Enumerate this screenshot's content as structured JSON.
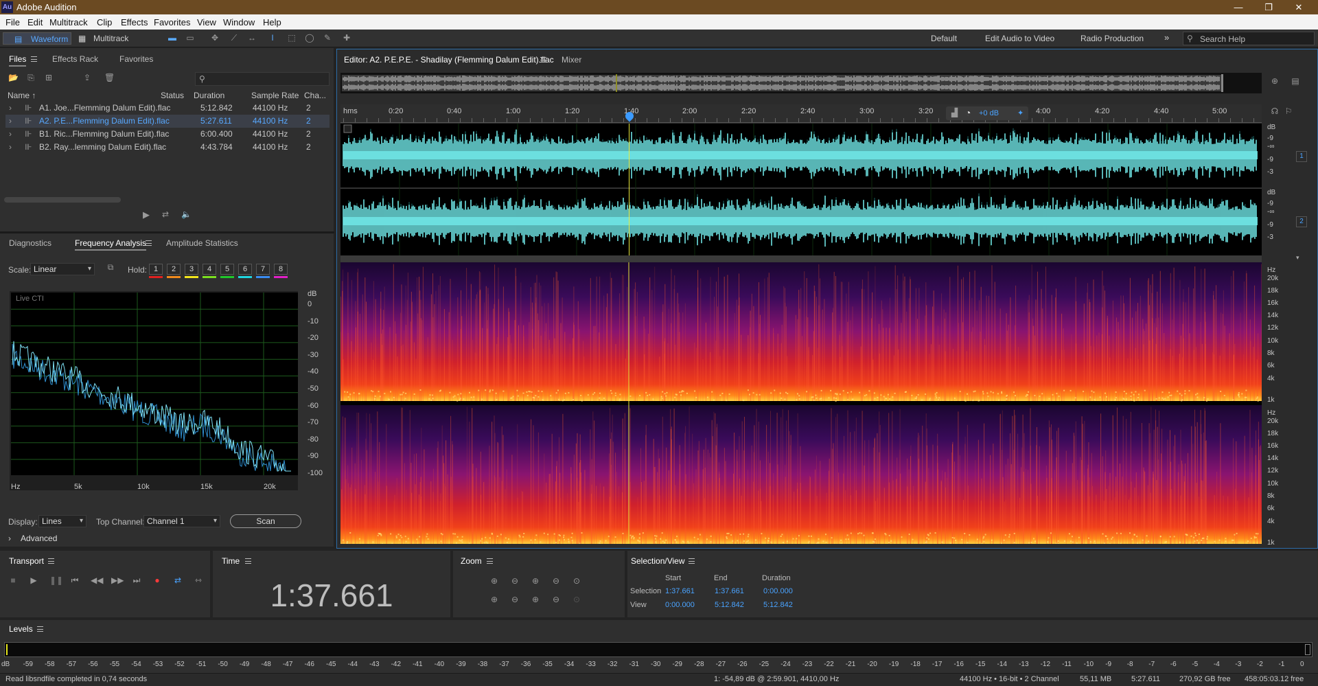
{
  "app": {
    "title": "Adobe Audition",
    "logo": "Au"
  },
  "menu": [
    "File",
    "Edit",
    "Multitrack",
    "Clip",
    "Effects",
    "Favorites",
    "View",
    "Window",
    "Help"
  ],
  "toolbar": {
    "waveform_label": "Waveform",
    "multitrack_label": "Multitrack",
    "workspaces": [
      "Default",
      "Edit Audio to Video",
      "Radio Production"
    ],
    "more": "»",
    "search_placeholder": "Search Help"
  },
  "files_panel": {
    "tabs": [
      "Files",
      "Effects Rack",
      "Favorites"
    ],
    "columns": [
      "Name ↑",
      "Status",
      "Duration",
      "Sample Rate",
      "Cha..."
    ],
    "rows": [
      {
        "name": "A1. Joe...Flemming Dalum Edit).flac",
        "duration": "5:12.842",
        "rate": "44100 Hz",
        "ch": "2",
        "selected": false
      },
      {
        "name": "A2. P.E...Flemming Dalum Edit).flac",
        "duration": "5:27.611",
        "rate": "44100 Hz",
        "ch": "2",
        "selected": true
      },
      {
        "name": "B1. Ric...Flemming Dalum Edit).flac",
        "duration": "6:00.400",
        "rate": "44100 Hz",
        "ch": "2",
        "selected": false
      },
      {
        "name": "B2. Ray...lemming Dalum Edit).flac",
        "duration": "4:43.784",
        "rate": "44100 Hz",
        "ch": "2",
        "selected": false
      }
    ]
  },
  "analysis_panel": {
    "tabs": [
      "Diagnostics",
      "Frequency Analysis",
      "Amplitude Statistics"
    ],
    "scale_label": "Scale:",
    "scale_value": "Linear",
    "hold_label": "Hold:",
    "hold_buttons": [
      "1",
      "2",
      "3",
      "4",
      "5",
      "6",
      "7",
      "8"
    ],
    "hold_colors": [
      "#e0201f",
      "#f08a1c",
      "#f2e51b",
      "#7be01f",
      "#1fc72a",
      "#1fd6e0",
      "#3a8cf2",
      "#e01fc7"
    ],
    "graph_label": "Live CTI",
    "db_unit": "dB",
    "db_ticks": [
      "0",
      "-10",
      "-20",
      "-30",
      "-40",
      "-50",
      "-60",
      "-70",
      "-80",
      "-90",
      "-100"
    ],
    "hz_ticks": [
      "Hz",
      "5k",
      "10k",
      "15k",
      "20k"
    ],
    "display_label": "Display:",
    "display_value": "Lines",
    "top_channel_label": "Top Channel:",
    "top_channel_value": "Channel 1",
    "scan_label": "Scan",
    "advanced_label": "Advanced"
  },
  "editor": {
    "tab_title": "Editor: A2. P.E.P.E. - Shadilay (Flemming Dalum Edit).flac",
    "mixer_tab": "Mixer",
    "ruler_unit": "hms",
    "ruler_ticks": [
      "0:20",
      "0:40",
      "1:00",
      "1:20",
      "1:40",
      "2:00",
      "2:20",
      "2:40",
      "3:00",
      "3:20",
      "4:00",
      "4:20",
      "4:40",
      "5:00"
    ],
    "gain_label": "+0 dB",
    "wave_db_labels": [
      "dB",
      "-9",
      "-∞",
      "-9",
      "-3"
    ],
    "channel_badges": [
      "1",
      "2"
    ],
    "spec_labels": [
      "Hz",
      "20k",
      "18k",
      "16k",
      "14k",
      "12k",
      "10k",
      "8k",
      "6k",
      "4k",
      "1k"
    ],
    "waveform_color": "#6fe3e3"
  },
  "transport": {
    "title": "Transport"
  },
  "time_panel": {
    "title": "Time",
    "current": "1:37.661"
  },
  "zoom_panel": {
    "title": "Zoom"
  },
  "selection_panel": {
    "title": "Selection/View",
    "headers": [
      "Start",
      "End",
      "Duration"
    ],
    "selection_label": "Selection",
    "selection": [
      "1:37.661",
      "1:37.661",
      "0:00.000"
    ],
    "view_label": "View",
    "view": [
      "0:00.000",
      "5:12.842",
      "5:12.842"
    ]
  },
  "levels": {
    "title": "Levels",
    "ticks": [
      "dB",
      "-59",
      "-58",
      "-57",
      "-56",
      "-55",
      "-54",
      "-53",
      "-52",
      "-51",
      "-50",
      "-49",
      "-48",
      "-47",
      "-46",
      "-45",
      "-44",
      "-43",
      "-42",
      "-41",
      "-40",
      "-39",
      "-38",
      "-37",
      "-36",
      "-35",
      "-34",
      "-33",
      "-32",
      "-31",
      "-30",
      "-29",
      "-28",
      "-27",
      "-26",
      "-25",
      "-24",
      "-23",
      "-22",
      "-21",
      "-20",
      "-19",
      "-18",
      "-17",
      "-16",
      "-15",
      "-14",
      "-13",
      "-12",
      "-11",
      "-10",
      "-9",
      "-8",
      "-7",
      "-6",
      "-5",
      "-4",
      "-3",
      "-2",
      "-1",
      "0"
    ]
  },
  "status_bar": {
    "message": "Read libsndfile completed in 0,74 seconds",
    "cursor_info": "1: -54,89 dB @ 2:59.901, 4410,00 Hz",
    "format": "44100 Hz • 16-bit • 2 Channel",
    "size": "55,11 MB",
    "duration": "5:27.611",
    "free": "270,92 GB free",
    "free_time": "458:05:03.12 free"
  }
}
